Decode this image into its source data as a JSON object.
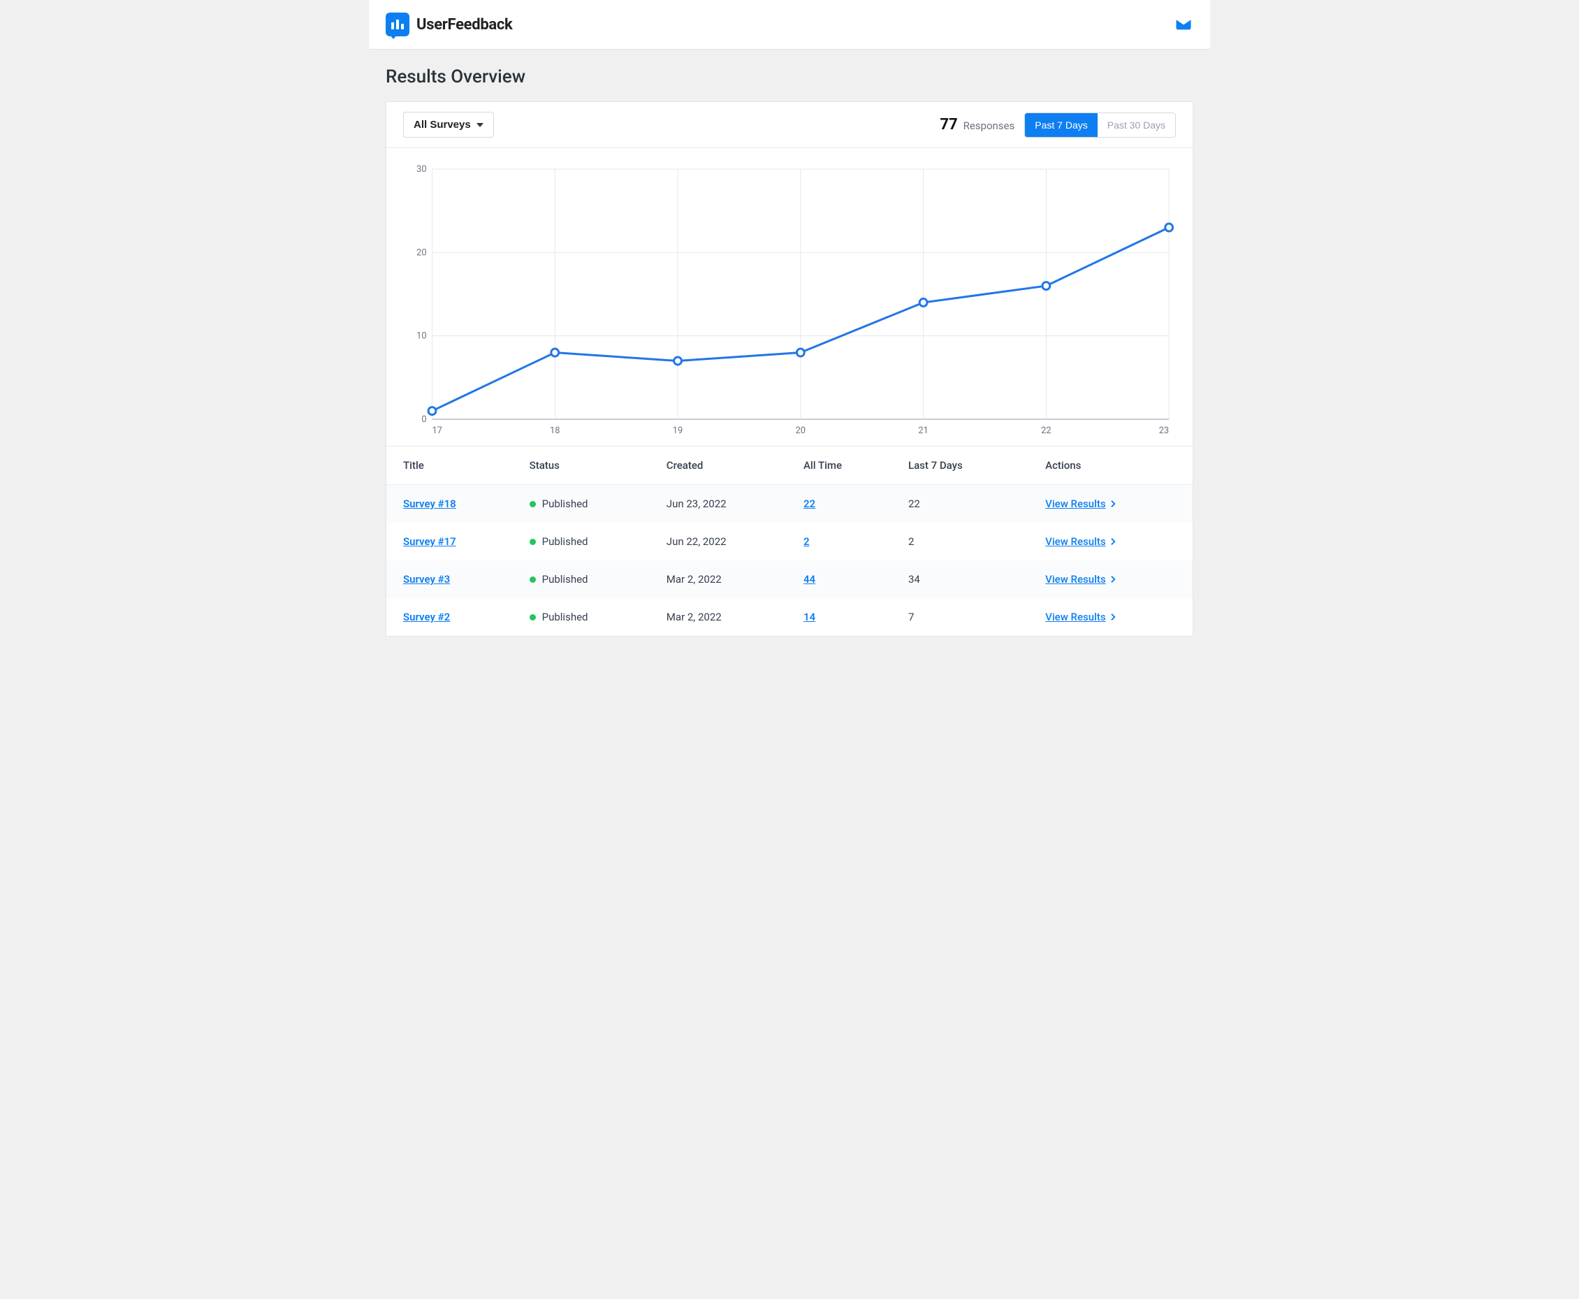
{
  "brand": {
    "name": "UserFeedback"
  },
  "page_title": "Results Overview",
  "filter": {
    "label": "All Surveys"
  },
  "responses": {
    "count": "77",
    "label": "Responses"
  },
  "range": {
    "opt1": "Past 7 Days",
    "opt2": "Past 30 Days",
    "active": "opt1"
  },
  "table": {
    "headers": {
      "title": "Title",
      "status": "Status",
      "created": "Created",
      "all_time": "All Time",
      "last7": "Last 7 Days",
      "actions": "Actions"
    },
    "action_label": "View Results",
    "rows": [
      {
        "title": "Survey #18",
        "status": "Published",
        "created": "Jun 23, 2022",
        "all_time": "22",
        "last7": "22"
      },
      {
        "title": "Survey #17",
        "status": "Published",
        "created": "Jun 22, 2022",
        "all_time": "2",
        "last7": "2"
      },
      {
        "title": "Survey #3",
        "status": "Published",
        "created": "Mar 2, 2022",
        "all_time": "44",
        "last7": "34"
      },
      {
        "title": "Survey #2",
        "status": "Published",
        "created": "Mar 2, 2022",
        "all_time": "14",
        "last7": "7"
      }
    ]
  },
  "chart_data": {
    "type": "line",
    "x": [
      17,
      18,
      19,
      20,
      21,
      22,
      23
    ],
    "values": [
      1,
      8,
      7,
      8,
      14,
      16,
      23
    ],
    "xlabel": "",
    "ylabel": "",
    "ylim": [
      0,
      30
    ],
    "yticks": [
      0,
      10,
      20,
      30
    ],
    "title": ""
  }
}
